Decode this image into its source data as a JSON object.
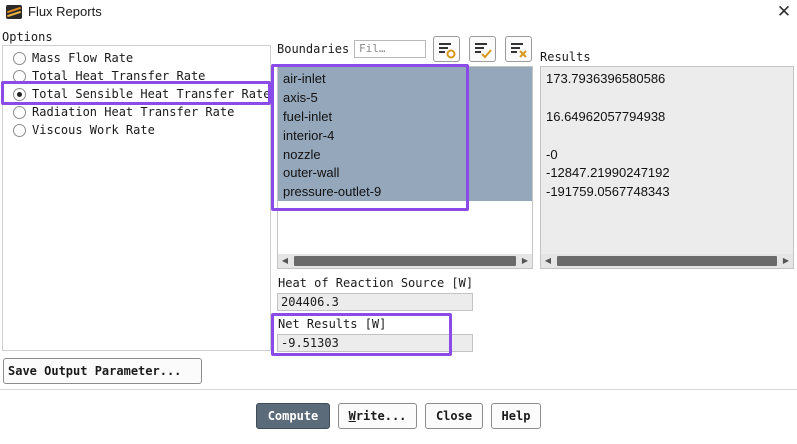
{
  "window": {
    "title": "Flux Reports",
    "close_glyph": "✕"
  },
  "options": {
    "label": "Options",
    "items": [
      {
        "label": "Mass Flow Rate",
        "selected": false
      },
      {
        "label": "Total Heat Transfer Rate",
        "selected": false
      },
      {
        "label": "Total Sensible Heat Transfer Rate",
        "selected": true
      },
      {
        "label": "Radiation Heat Transfer Rate",
        "selected": false
      },
      {
        "label": "Viscous Work Rate",
        "selected": false
      }
    ]
  },
  "boundaries": {
    "label": "Boundaries",
    "filter_placeholder": "Fil…",
    "items": [
      "air-inlet",
      "axis-5",
      "fuel-inlet",
      "interior-4",
      "nozzle",
      "outer-wall",
      "pressure-outlet-9"
    ],
    "selection_color": "#94a7bb"
  },
  "results": {
    "label": "Results",
    "values": [
      "173.7936396580586",
      "",
      "16.64962057794938",
      "",
      "-0",
      "-12847.21990247192",
      "-191759.0567748343"
    ]
  },
  "heat_of_reaction": {
    "label": "Heat of Reaction Source [W]",
    "value": "204406.3"
  },
  "net_results": {
    "label": "Net Results [W]",
    "value": "-9.51303"
  },
  "buttons": {
    "save_output": "Save Output Parameter...",
    "compute": "Compute",
    "write": "Write...",
    "close": "Close",
    "help": "Help"
  },
  "icons": {
    "app": "fluent-app-icon",
    "filter_toolbar": [
      "filter-options-icon",
      "select-all-icon",
      "deselect-all-icon"
    ]
  },
  "colors": {
    "highlight": "#8b4be8",
    "primary_button": "#5b6b7a"
  }
}
